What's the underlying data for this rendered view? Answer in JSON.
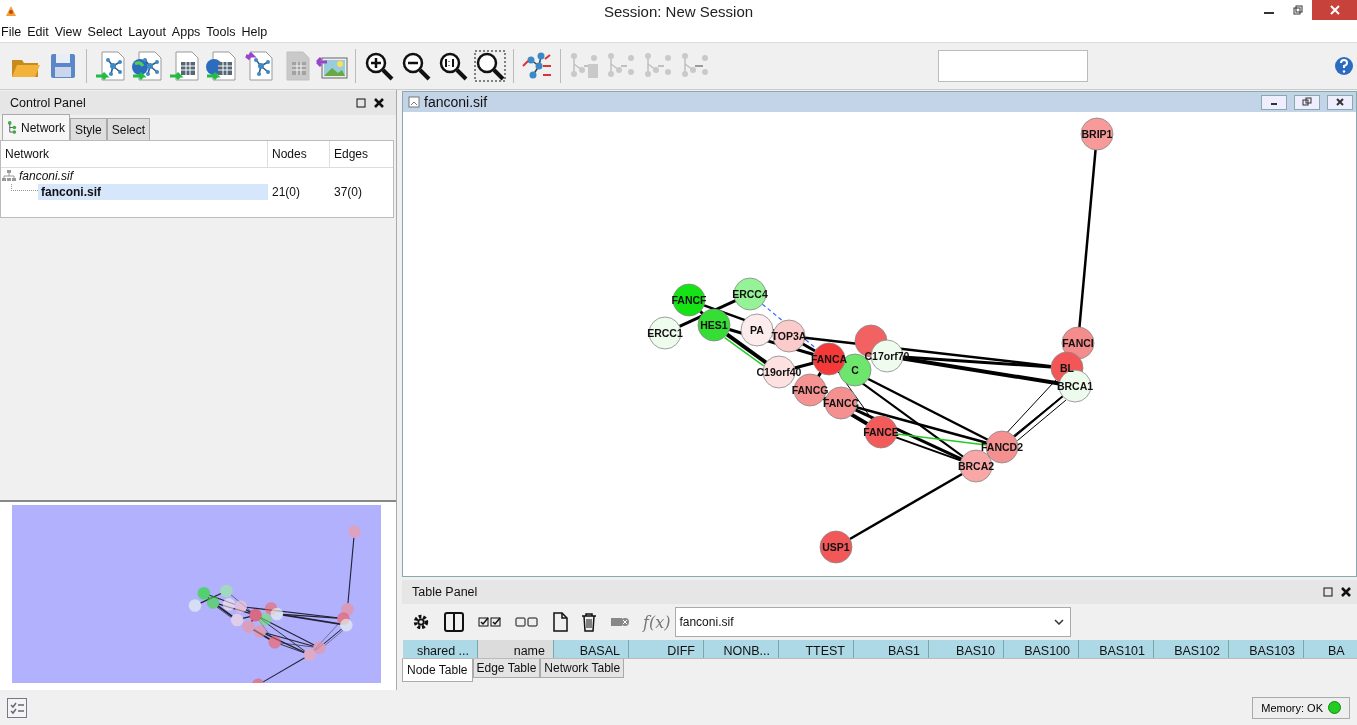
{
  "window": {
    "title": "Session: New Session"
  },
  "menu": [
    "File",
    "Edit",
    "View",
    "Select",
    "Layout",
    "Apps",
    "Tools",
    "Help"
  ],
  "toolbar": [
    {
      "kind": "open",
      "disabled": false
    },
    {
      "kind": "save",
      "disabled": false
    },
    {
      "kind": "sep"
    },
    {
      "kind": "import-network",
      "disabled": false
    },
    {
      "kind": "import-network-web",
      "disabled": false
    },
    {
      "kind": "import-table",
      "disabled": false
    },
    {
      "kind": "import-table-web",
      "disabled": false
    },
    {
      "kind": "export-network",
      "disabled": false
    },
    {
      "kind": "export-table",
      "disabled": true
    },
    {
      "kind": "export-image",
      "disabled": false
    },
    {
      "kind": "sep"
    },
    {
      "kind": "zoom-in",
      "disabled": false
    },
    {
      "kind": "zoom-out",
      "disabled": false
    },
    {
      "kind": "zoom-actual",
      "disabled": false
    },
    {
      "kind": "zoom-selected",
      "disabled": false
    },
    {
      "kind": "sep"
    },
    {
      "kind": "layout",
      "disabled": false
    },
    {
      "kind": "sep"
    },
    {
      "kind": "net-table",
      "disabled": true
    },
    {
      "kind": "net-star",
      "disabled": true
    },
    {
      "kind": "net-merge",
      "disabled": true
    },
    {
      "kind": "net-path",
      "disabled": true
    }
  ],
  "control_panel": {
    "title": "Control Panel",
    "tabs": [
      {
        "label": "Network",
        "selected": true
      },
      {
        "label": "Style",
        "selected": false
      },
      {
        "label": "Select",
        "selected": false
      }
    ],
    "columns": [
      "Network",
      "Nodes",
      "Edges"
    ],
    "tree": [
      {
        "name": "fanconi.sif",
        "children": [
          {
            "name": "fanconi.sif",
            "nodes": "21(0)",
            "edges": "37(0)",
            "selected": true
          }
        ]
      }
    ]
  },
  "network_view": {
    "title": "fanconi.sif",
    "nodes": [
      {
        "label": "BRIP1",
        "color": "#f89a9a"
      },
      {
        "label": "FANCI",
        "color": "#f48c8c"
      },
      {
        "label": "BL",
        "color": "#f25656"
      },
      {
        "label": "BRCA1",
        "color": "#ecfbec"
      },
      {
        "label": "FANCF",
        "color": "#16e316"
      },
      {
        "label": "ERCC4",
        "color": "#96f296"
      },
      {
        "label": "ERCC1",
        "color": "#eefcee"
      },
      {
        "label": "HES1",
        "color": "#34de34"
      },
      {
        "label": "PA",
        "color": "#fdecec"
      },
      {
        "label": "TOP3A",
        "color": "#fbcaca"
      },
      {
        "color": "#f36262"
      },
      {
        "label": "C",
        "color": "#6ee66e"
      },
      {
        "label": "FANCA",
        "color": "#f53838"
      },
      {
        "label": "C17orf70",
        "color": "#eefcee"
      },
      {
        "label": "C19orf40",
        "color": "#fde0e0"
      },
      {
        "label": "FANCG",
        "color": "#f59292"
      },
      {
        "label": "FANCC",
        "color": "#f59090"
      },
      {
        "label": "FANCE",
        "color": "#f35a5a"
      },
      {
        "label": "FANCD2",
        "color": "#f59090"
      },
      {
        "label": "BRCA2",
        "color": "#f8a6a6"
      },
      {
        "label": "USP1",
        "color": "#f25858"
      }
    ]
  },
  "table_panel": {
    "title": "Table Panel",
    "function_label": "f(x)",
    "network": "fanconi.sif",
    "columns": [
      {
        "label": "shared ...",
        "selected": false
      },
      {
        "label": "name",
        "selected": true
      },
      {
        "label": "BASAL",
        "selected": false
      },
      {
        "label": "DIFF",
        "selected": false
      },
      {
        "label": "NONB...",
        "selected": false
      },
      {
        "label": "TTEST",
        "selected": false
      },
      {
        "label": "BAS1",
        "selected": false
      },
      {
        "label": "BAS10",
        "selected": false
      },
      {
        "label": "BAS100",
        "selected": false
      },
      {
        "label": "BAS101",
        "selected": false
      },
      {
        "label": "BAS102",
        "selected": false
      },
      {
        "label": "BAS103",
        "selected": false
      },
      {
        "label": "BA",
        "selected": false
      }
    ],
    "tabs": [
      {
        "label": "Node Table",
        "selected": true
      },
      {
        "label": "Edge Table",
        "selected": false
      },
      {
        "label": "Network Table",
        "selected": false
      }
    ]
  },
  "status_bar": {
    "memory": "Memory: OK"
  }
}
